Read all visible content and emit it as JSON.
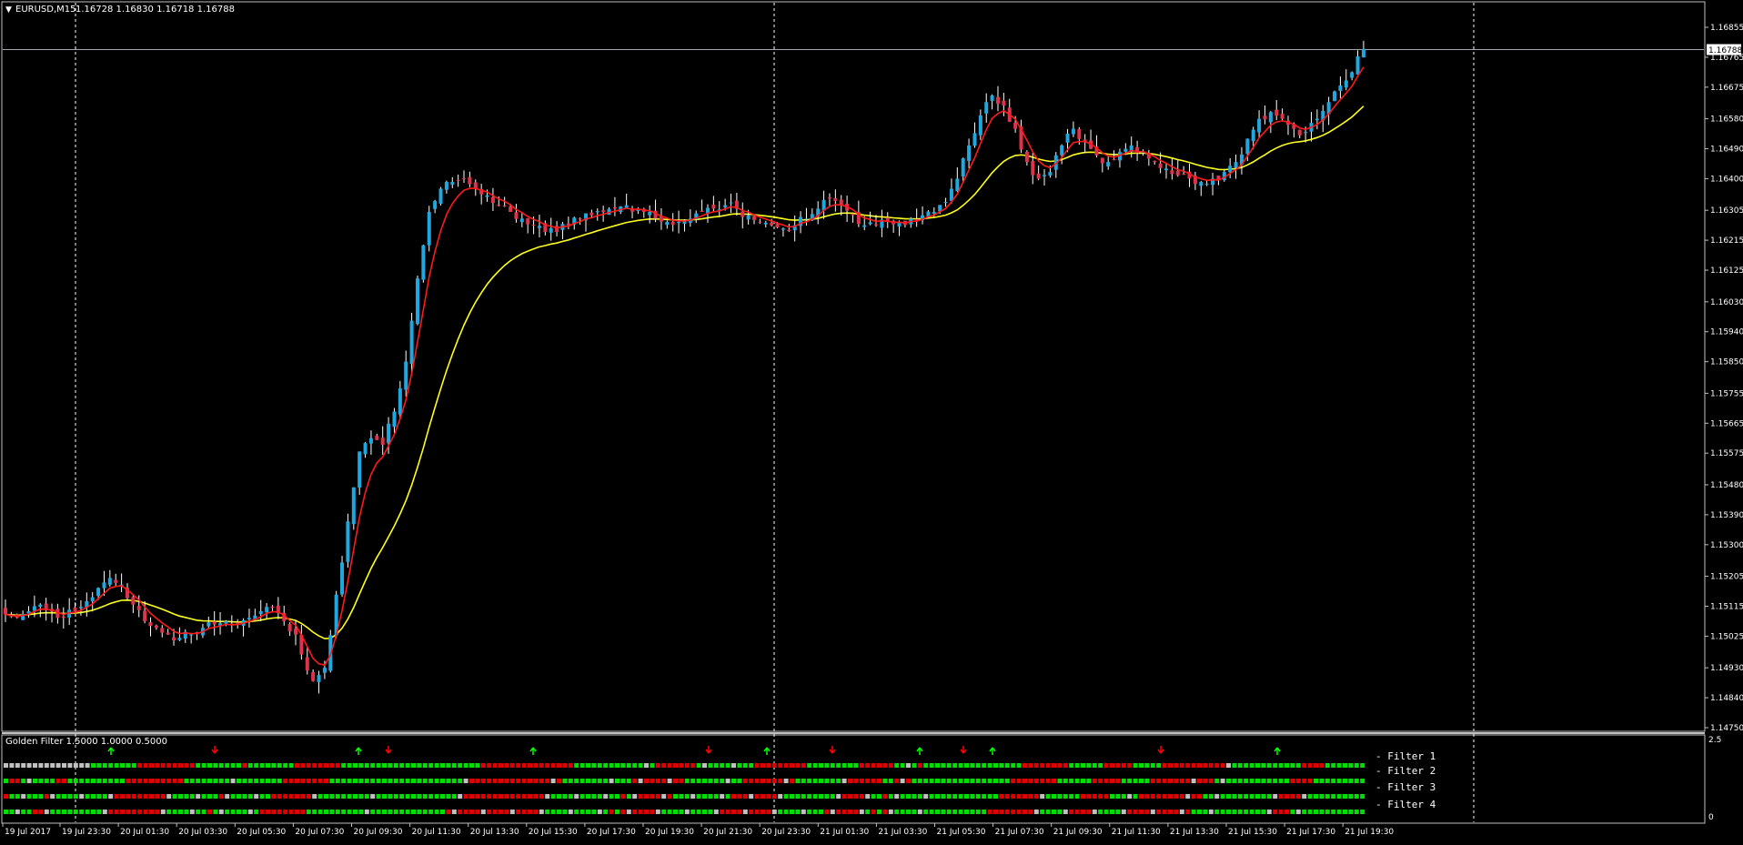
{
  "window": {
    "title_arrow": "▼",
    "symbol": "EURUSD,M15",
    "ohlc": "1.16728 1.16830 1.16718 1.16788"
  },
  "colors": {
    "background": "#000000",
    "frame": "#c0c0c0",
    "bull_body": "#1fa8e0",
    "bear_body": "#e0324a",
    "fast_ma": "#ff1a1a",
    "slow_ma": "#ffff1a",
    "filter_green": "#00e000",
    "filter_red": "#e00000",
    "filter_gray": "#c0c0c0",
    "arrow_up": "#00ff00",
    "arrow_down": "#ff0000"
  },
  "price_axis": {
    "labels": [
      "1.16855",
      "1.16765",
      "1.16675",
      "1.16580",
      "1.16490",
      "1.16400",
      "1.16305",
      "1.16215",
      "1.16125",
      "1.16030",
      "1.15940",
      "1.15850",
      "1.15755",
      "1.15665",
      "1.15575",
      "1.15480",
      "1.15390",
      "1.15300",
      "1.15205",
      "1.15115",
      "1.15025",
      "1.14930",
      "1.14840",
      "1.14750"
    ],
    "current_price": "1.16788",
    "min": 1.1475,
    "max": 1.16855
  },
  "time_axis": {
    "labels": [
      "19 Jul 2017",
      "19 Jul 23:30",
      "20 Jul 01:30",
      "20 Jul 03:30",
      "20 Jul 05:30",
      "20 Jul 07:30",
      "20 Jul 09:30",
      "20 Jul 11:30",
      "20 Jul 13:30",
      "20 Jul 15:30",
      "20 Jul 17:30",
      "20 Jul 19:30",
      "20 Jul 21:30",
      "20 Jul 23:30",
      "21 Jul 01:30",
      "21 Jul 03:30",
      "21 Jul 05:30",
      "21 Jul 07:30",
      "21 Jul 09:30",
      "21 Jul 11:30",
      "21 Jul 13:30",
      "21 Jul 15:30",
      "21 Jul 17:30",
      "21 Jul 19:30"
    ]
  },
  "indicator": {
    "title": "Golden Filter 1.5000 1.0000 0.5000",
    "scale_top": "2.5",
    "scale_bottom": "0",
    "filter_labels": [
      "- Filter 1",
      "- Filter 2",
      "- Filter 3",
      "- Filter 4"
    ],
    "up_arrows_at_label": [
      "19 Jul 23:30+",
      "20 Jul 09:30",
      "20 Jul 15:30",
      "20 Jul 23:30",
      "21 Jul 03:30",
      "21 Jul 07:30",
      "21 Jul 17:30"
    ],
    "down_arrows_at_label": [
      "20 Jul 03:30",
      "20 Jul 09:30+",
      "20 Jul 21:30",
      "21 Jul 01:30",
      "21 Jul 05:30",
      "21 Jul 11:30"
    ]
  },
  "chart_data": {
    "type": "candlestick",
    "symbol": "EURUSD",
    "timeframe": "M15",
    "ylim": [
      1.1475,
      1.16855
    ],
    "series": [
      {
        "name": "price",
        "segments": [
          [
            1.152,
            1.1518,
            1.152,
            1.1518,
            1.1517,
            1.1515,
            1.1513,
            1.1514,
            1.1512,
            1.1514,
            1.1515,
            1.1518,
            1.1522,
            1.1526,
            1.153,
            1.1531,
            1.1529,
            1.1527,
            1.1526,
            1.1523,
            1.1521,
            1.1519,
            1.1518,
            1.152,
            1.1521,
            1.1522,
            1.152,
            1.1515
          ],
          [
            1.1515,
            1.1509,
            1.1508,
            1.151,
            1.1512,
            1.151,
            1.1508,
            1.151,
            1.1513,
            1.1517,
            1.152,
            1.1518,
            1.1512,
            1.1507,
            1.1505,
            1.1503,
            1.1502,
            1.1503,
            1.1505,
            1.1506,
            1.1507,
            1.1506,
            1.1508,
            1.151,
            1.1511,
            1.1507,
            1.1503
          ],
          [
            1.1497,
            1.1489,
            1.1493,
            1.1515,
            1.1537,
            1.1558,
            1.1562,
            1.156,
            1.157,
            1.1585,
            1.161,
            1.163,
            1.1637,
            1.1639,
            1.164,
            1.1637,
            1.1635,
            1.1632,
            1.163,
            1.1628,
            1.1626,
            1.1624,
            1.1624,
            1.1626,
            1.1628,
            1.1629,
            1.163,
            1.1631,
            1.1632,
            1.1631,
            1.163
          ],
          [
            1.1628,
            1.1627,
            1.1627,
            1.1628,
            1.163,
            1.1631,
            1.1632,
            1.1631,
            1.1629,
            1.1627,
            1.1626,
            1.1625,
            1.1626,
            1.1628,
            1.1631,
            1.1634,
            1.1632,
            1.1629,
            1.1626,
            1.1626,
            1.1627,
            1.1627,
            1.1628,
            1.1629,
            1.163,
            1.1633,
            1.164,
            1.165,
            1.1659,
            1.1665,
            1.1662,
            1.1655,
            1.1645,
            1.164,
            1.1642,
            1.165,
            1.1655,
            1.1651,
            1.1647,
            1.1645,
            1.1648,
            1.165,
            1.1648,
            1.1645,
            1.1643,
            1.1641,
            1.164,
            1.1639,
            1.164,
            1.1642,
            1.1645,
            1.1652,
            1.1658,
            1.166,
            1.1658,
            1.1655,
            1.1654,
            1.1658,
            1.1663,
            1.1668,
            1.1672,
            1.1679
          ]
        ]
      }
    ],
    "moving_averages": [
      {
        "name": "fast",
        "color": "#ff1a1a"
      },
      {
        "name": "slow",
        "color": "#ffff1a"
      }
    ]
  }
}
